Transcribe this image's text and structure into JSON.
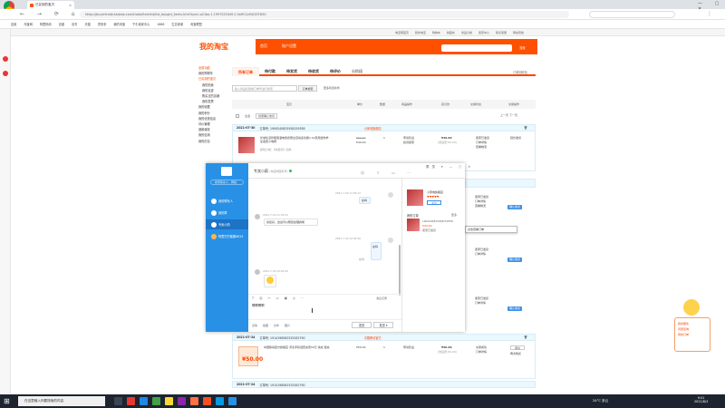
{
  "browser": {
    "tab_title": "已买到的宝贝",
    "url": "https://buyertrade.taobao.com/trade/itemlist/list_bought_items.htm?spm=a21bo.1.1997525049.2.5af911d9jCIGFDS0",
    "bookmarks": [
      "应用",
      "淘宝网",
      "阿里妈妈",
      "百度",
      "京东",
      "天猫",
      "拼多多",
      "我的淘宝",
      "千牛卖家中心",
      "1688",
      "生意参谋",
      "淘宝联盟"
    ]
  },
  "taobao": {
    "topbar": [
      "淘宝网首页",
      "我的淘宝",
      "购物车",
      "收藏夹",
      "商品分类",
      "卖家中心",
      "联系客服",
      "网站导航"
    ],
    "logo": "我的淘宝",
    "nav_home": "首页",
    "nav_account": "账户设置",
    "search_btn": "搜索"
  },
  "sidebar": {
    "items": [
      "全部功能",
      "我的购物车",
      "已买到的宝贝",
      "我的拍卖",
      "我的足迹",
      "购买过的店铺",
      "我的发票",
      "我的收藏",
      "我的积分",
      "我的优惠信息",
      "评价管理",
      "退款维权",
      "我的信用",
      "我的红包"
    ]
  },
  "order_tabs": [
    {
      "label": "所有订单",
      "active": true
    },
    {
      "label": "待付款",
      "active": false
    },
    {
      "label": "待发货",
      "active": false
    },
    {
      "label": "待收货",
      "active": false
    },
    {
      "label": "待评价",
      "active": false
    },
    {
      "label": "分阶段",
      "active": false
    }
  ],
  "recycle_bin": "订单回收站",
  "order_search": {
    "placeholder": "输入商品标题或订单号进行搜索",
    "button": "订单搜索",
    "more": "更多筛选条件"
  },
  "columns": [
    "宝贝",
    "单价",
    "数量",
    "商品操作",
    "实付款",
    "交易状态",
    "交易操作"
  ],
  "select_all": "全选",
  "merge_pay": "批量确认收货",
  "pager": "上一页  下一页",
  "orders": [
    {
      "date": "2021-07-30",
      "order_no": "订单号: 1909240825928159358",
      "shop": "小家电旗舰店",
      "title": "长城生活智能保温电煲煮粥全自动多功能1.5L家用迷你学生宿舍小电锅",
      "sku": "颜色分类：【热卖款】加热",
      "price_orig": "¥59.00",
      "price": "¥49.00",
      "qty": "1",
      "actions": [
        "申请售后",
        "投诉卖家"
      ],
      "total": "¥49.00",
      "total_note": "(含运费:¥0.00)",
      "status": [
        "卖家已发货",
        "订单详情",
        "查看物流"
      ],
      "op_btn": "确认收货",
      "op_extra": [
        "延长收货"
      ]
    },
    {
      "date": "2021-07-24",
      "order_no": "订单号: 1914198562525262790",
      "shop": "中国移动官方",
      "title": "中国移动官方旗舰店 河北手机话费充值50元 快充 慢充",
      "sku": "",
      "price_orig": "",
      "price": "¥50.00",
      "qty": "1",
      "actions": [
        "申请售后"
      ],
      "total": "¥50.00",
      "total_note": "(含运费:¥0.00)",
      "status": [
        "交易成功",
        "订单详情"
      ],
      "op_btn": "评价",
      "op_extra": [
        "再次购买"
      ]
    }
  ],
  "chat": {
    "contact_title": "专卖小蔚",
    "contact_sub": "(淘宝网服务号)",
    "search_placeholder": "搜索联系人、群组",
    "contacts": [
      {
        "name": "我的联系人",
        "selected": false
      },
      {
        "name": "我的群",
        "selected": false
      },
      {
        "name": "专卖小蔚",
        "selected": true
      },
      {
        "name": "阿里巴巴客服6619",
        "selected": false
      }
    ],
    "messages": [
      {
        "time": "2021-7-30 11:59:13",
        "text": "在吗",
        "me": true
      },
      {
        "time": "2021-7-30 11:59:32",
        "text": "亲您好，这边可以帮您处理的呢",
        "me": false
      },
      {
        "time": "2021-7-30 12:00:40",
        "text": "在吗",
        "me": true
      },
      {
        "time": "2021-7-30 12:01:00",
        "text": "",
        "me": false
      }
    ],
    "input_text": "啊啊啊啊",
    "send_label": "发送",
    "send_mode_label": "发送",
    "bottom_links": [
      "表情",
      "截图",
      "文件",
      "图片"
    ],
    "history_label": "消息记录",
    "right_panel": {
      "shop_name": "小家电旗舰店",
      "follow": "关注",
      "order_card_title": "我的订单",
      "order_card_more": "更多",
      "order_no": "1909240825928159358",
      "order_price": "¥49.00",
      "order_status": "卖家已发货"
    },
    "tooltip": "点击查看订单"
  },
  "widget": {
    "line1": "我的服务",
    "line2": "问题咨询",
    "line3": "我的订单"
  },
  "taskbar": {
    "search_placeholder": "在这里输入你要搜索的内容",
    "weather": "24°C 多云",
    "time": "9:01",
    "date": "2021/8/3"
  }
}
